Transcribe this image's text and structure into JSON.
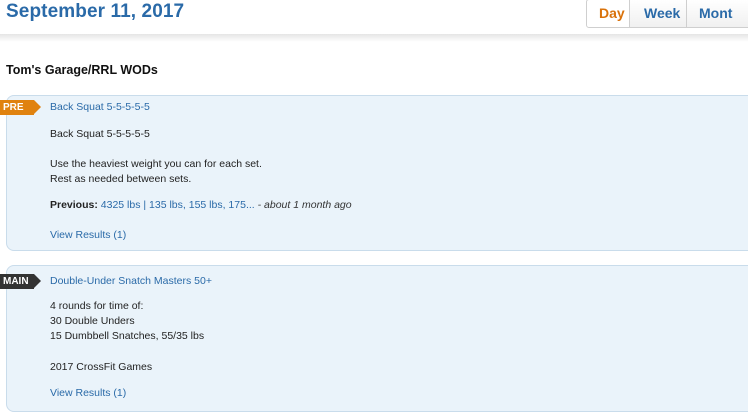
{
  "header": {
    "date": "September 11, 2017",
    "tabs": [
      {
        "label": "Day",
        "active": true
      },
      {
        "label": "Week",
        "active": false
      },
      {
        "label": "Mont",
        "active": false
      }
    ]
  },
  "section_title": "Tom's Garage/RRL WODs",
  "workouts": [
    {
      "badge": "PRE",
      "title": "Back Squat 5-5-5-5-5",
      "lines": [
        "Back Squat 5-5-5-5-5",
        "",
        "Use the heaviest weight you can for each set.",
        "Rest as needed between sets."
      ],
      "previous_label": "Previous:",
      "previous_value": "4325 lbs | 135 lbs, 155 lbs, 175...",
      "previous_time": "- about 1 month ago",
      "results_link": "View Results (1)"
    },
    {
      "badge": "MAIN",
      "title": "Double-Under Snatch Masters 50+",
      "lines": [
        "4 rounds for time of:",
        "30 Double Unders",
        "15 Dumbbell Snatches, 55/35 lbs",
        "",
        "2017 CrossFit Games"
      ],
      "results_link": "View Results (1)"
    }
  ],
  "colors": {
    "accent_blue": "#2a6aa8",
    "active_tab": "#d9720b",
    "pre_badge": "#e0820f",
    "main_badge": "#333333",
    "card_bg": "#eaf3fa"
  }
}
